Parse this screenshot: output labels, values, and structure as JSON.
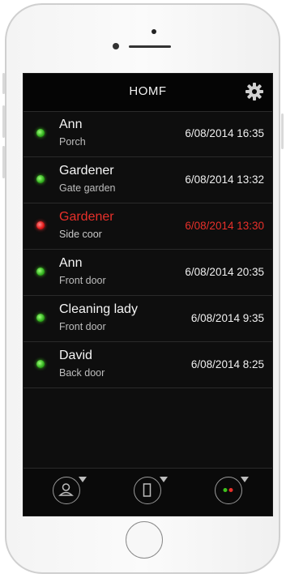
{
  "header": {
    "title": "HOMF"
  },
  "events": [
    {
      "name": "Ann",
      "place": "Porch",
      "time": "6/08/2014 16:35",
      "status": "green"
    },
    {
      "name": "Gardener",
      "place": "Gate garden",
      "time": "6/08/2014 13:32",
      "status": "green"
    },
    {
      "name": "Gardener",
      "place": "Side coor",
      "time": "6/08/2014 13:30",
      "status": "red"
    },
    {
      "name": "Ann",
      "place": "Front door",
      "time": "6/08/2014 20:35",
      "status": "green"
    },
    {
      "name": "Cleaning lady",
      "place": "Front door",
      "time": "6/08/2014 9:35",
      "status": "green"
    },
    {
      "name": "David",
      "place": "Back door",
      "time": "6/08/2014  8:25",
      "status": "green"
    }
  ],
  "footer": {
    "icons": [
      "person-icon",
      "door-icon",
      "status-lights-icon"
    ]
  },
  "colors": {
    "alert": "#e8302a",
    "ok": "#2fae1c",
    "screen_bg": "#0e0e0e"
  }
}
